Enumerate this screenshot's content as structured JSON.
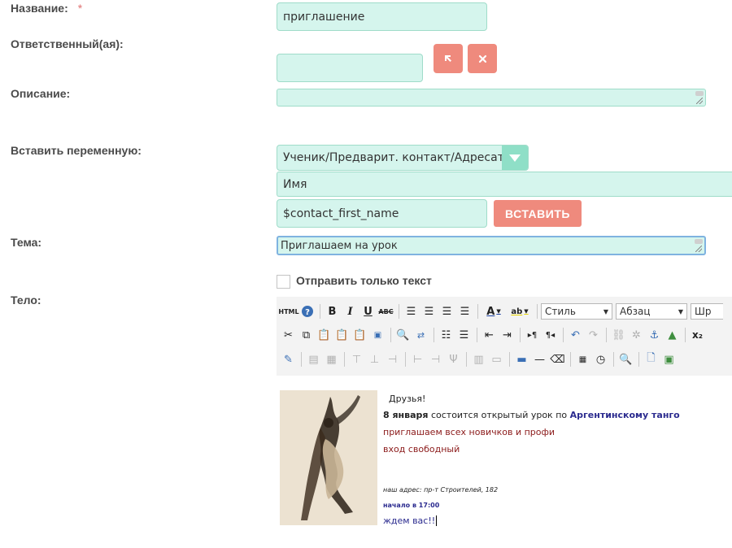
{
  "form": {
    "name_label": "Название:",
    "name_required_mark": "*",
    "name_value": "приглашение",
    "responsible_label": "Ответственный(ая):",
    "responsible_value": "",
    "description_label": "Описание:",
    "description_value": "",
    "insert_var_label": "Вставить переменную:",
    "var_category": "Ученик/Предварит. контакт/Адресат",
    "var_field": "Имя",
    "var_code": "$contact_first_name",
    "insert_button": "ВСТАВИТЬ",
    "subject_label": "Тема:",
    "subject_value": "Приглашаем на урок",
    "text_only_label": "Отправить только текст",
    "text_only_checked": false,
    "body_label": "Тело:"
  },
  "toolbar": {
    "html_label": "HTML",
    "style_combo": "Стиль",
    "paragraph_combo": "Абзац",
    "font_combo": "Шр"
  },
  "editor": {
    "greeting": "Друзья!",
    "date_bold": "8 января",
    "line1_middle": "состоится открытый урок по",
    "line1_link": "Аргентинскому танго",
    "line2": "приглашаем всех новичков и профи",
    "line3": "вход свободный",
    "address": "наш адрес: пр-т Строителей, 182",
    "start_time": "начало в 17:00",
    "closing": "ждем вас!!"
  },
  "colors": {
    "field_bg": "#d5f5ed",
    "field_border": "#9fdcc9",
    "accent_button": "#ef8a7d",
    "select_arrow_bg": "#8fdfc7",
    "dark_red_text": "#8b1a1a",
    "blue_text": "#2b2b8f"
  }
}
